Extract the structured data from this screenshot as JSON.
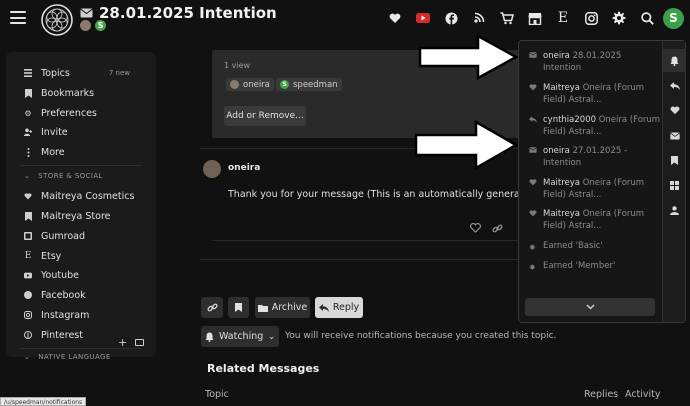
{
  "header": {
    "topic_title": "28.01.2025 Intention",
    "participant_badge": "S",
    "user_avatar_letter": "S",
    "icons": [
      "heart-icon",
      "youtube-icon",
      "facebook-icon",
      "podcast-icon",
      "cart-icon",
      "store-icon",
      "etsy-icon",
      "instagram-icon",
      "gear-icon",
      "search-icon"
    ]
  },
  "sidebar": {
    "items": [
      {
        "label": "Topics",
        "icon": "list-icon"
      },
      {
        "label": "Bookmarks",
        "icon": "bookmark-icon"
      },
      {
        "label": "Preferences",
        "icon": "gear-icon"
      },
      {
        "label": "Invite",
        "icon": "invite-icon"
      },
      {
        "label": "More",
        "icon": "more-icon"
      }
    ],
    "topics_count": "7 new",
    "section_store": "STORE & SOCIAL",
    "store_items": [
      {
        "label": "Maitreya Cosmetics",
        "icon": "heart-icon"
      },
      {
        "label": "Maitreya Store",
        "icon": "bookmark-icon"
      },
      {
        "label": "Gumroad",
        "icon": "gumroad-icon"
      },
      {
        "label": "Etsy",
        "icon": "etsy-icon"
      },
      {
        "label": "Youtube",
        "icon": "youtube-icon"
      },
      {
        "label": "Facebook",
        "icon": "facebook-icon"
      },
      {
        "label": "Instagram",
        "icon": "instagram-icon"
      },
      {
        "label": "Pinterest",
        "icon": "pinterest-icon"
      }
    ],
    "section_lang": "NATIVE LANGUAGE"
  },
  "topic_box": {
    "views": "1 view",
    "participants": [
      "oneira",
      "speedman"
    ],
    "participant_badge": "S",
    "add_button": "Add or Remove..."
  },
  "post": {
    "username": "oneira",
    "body": "Thank you for your message (This is an automatically generated message"
  },
  "footer": {
    "archive": "Archive",
    "reply": "Reply",
    "watching": "Watching",
    "watching_note": "You will receive notifications because you created this topic."
  },
  "related": {
    "title": "Related Messages",
    "col_topic": "Topic",
    "col_replies": "Replies",
    "col_activity": "Activity"
  },
  "statusbar": "/u/speedman/notifications",
  "notifications": [
    {
      "user": "oneira",
      "text": "28.01.2025 Intention",
      "icon": "envelope-icon"
    },
    {
      "user": "Maitreya",
      "text": "Oneira (Forum Field) Astral...",
      "icon": "heart-icon"
    },
    {
      "user": "cynthia2000",
      "text": "Oneira (Forum Field) Astral...",
      "icon": "reply-icon"
    },
    {
      "user": "oneira",
      "text": "27.01.2025 - Intention",
      "icon": "envelope-icon"
    },
    {
      "user": "Maitreya",
      "text": "Oneira (Forum Field) Astral...",
      "icon": "heart-icon"
    },
    {
      "user": "Maitreya",
      "text": "Oneira (Forum Field) Astral...",
      "icon": "heart-icon"
    },
    {
      "user": "",
      "text": "Earned 'Basic'",
      "icon": "badge-icon"
    },
    {
      "user": "",
      "text": "Earned 'Member'",
      "icon": "badge-icon"
    }
  ],
  "notification_tabs": [
    "bell-icon",
    "reply-icon",
    "heart-icon",
    "envelope-icon",
    "bookmark-icon",
    "grid-icon",
    "person-icon"
  ]
}
